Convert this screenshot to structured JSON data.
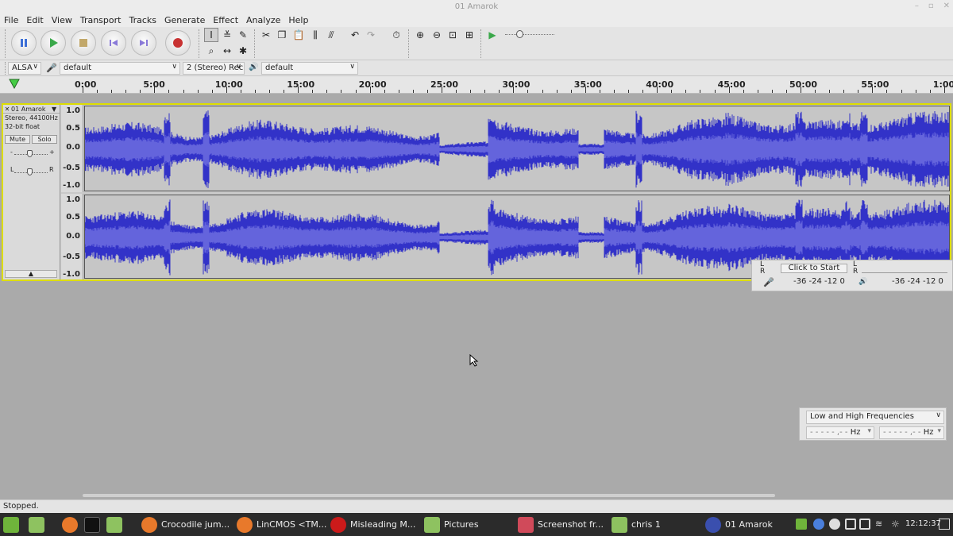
{
  "window": {
    "title": "01 Amarok"
  },
  "menu": [
    "File",
    "Edit",
    "View",
    "Transport",
    "Tracks",
    "Generate",
    "Effect",
    "Analyze",
    "Help"
  ],
  "device": {
    "host": "ALSA",
    "recording_device": "default",
    "channels": "2 (Stereo) Rec",
    "playback_device": "default"
  },
  "ruler": [
    "0:00",
    "5:00",
    "10:00",
    "15:00",
    "20:00",
    "25:00",
    "30:00",
    "35:00",
    "40:00",
    "45:00",
    "50:00",
    "55:00",
    "1:00:00"
  ],
  "track": {
    "name": "01 Amarok",
    "format": "Stereo, 44100Hz",
    "bit_depth": "32-bit float",
    "mute_label": "Mute",
    "solo_label": "Solo",
    "gain_minus": "-",
    "gain_plus": "+",
    "pan_left": "L",
    "pan_right": "R",
    "scale": [
      "1.0",
      "0.5",
      "0.0",
      "-0.5",
      "-1.0"
    ]
  },
  "meter": {
    "left": "L",
    "right": "R",
    "click_to_start": "Click to Start",
    "rec_scale": "-36 -24 -12 0",
    "play_scale": "-36 -24 -12 0"
  },
  "eq": {
    "preset": "Low and High Frequencies",
    "low_value": "- - - - - ,- -",
    "low_unit": "Hz",
    "high_value": "- - - - - ,- -",
    "high_unit": "Hz"
  },
  "status": "Stopped.",
  "taskbar": {
    "items": [
      "Crocodile jum...",
      "LinCMOS <TM...",
      "Misleading M...",
      "Pictures",
      "Screenshot fr...",
      "chris 1",
      "01 Amarok"
    ],
    "clock": "12:12:37"
  },
  "colors": {
    "wave": "#3232c8",
    "wave_rms": "#6464dc",
    "selection_border": "#dddd00"
  }
}
